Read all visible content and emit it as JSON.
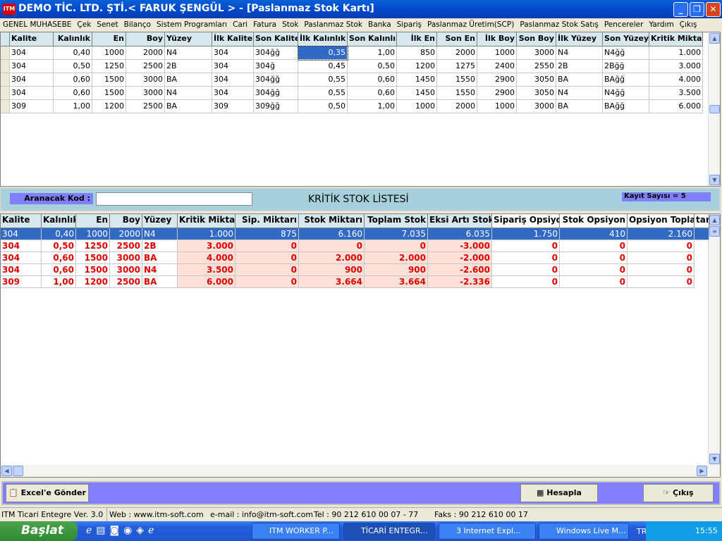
{
  "window": {
    "title": "DEMO TİC. LTD. ŞTİ.< FARUK ŞENGÜL  > - [Paslanmaz Stok Kartı]",
    "logo": "ITM",
    "minimize": "_",
    "restore": "❐",
    "close": "✕"
  },
  "menu": [
    "GENEL MUHASEBE",
    "Çek",
    "Senet",
    "Bilanço",
    "Sistem Programları",
    "Cari",
    "Fatura",
    "Stok",
    "Paslanmaz Stok",
    "Banka",
    "Sipariş",
    "Paslanmaz Üretim(SCP)",
    "Paslanmaz Stok Satış",
    "Pencereler",
    "Yardım",
    "Çıkış"
  ],
  "top_grid": {
    "columns": [
      "Kalite",
      "Kalınlık",
      "En",
      "Boy",
      "Yüzey",
      "İlk Kalite",
      "Son Kalite",
      "İlk Kalınlık",
      "Son Kalınlık",
      "İlk En",
      "Son En",
      "İlk Boy",
      "Son Boy",
      "İlk Yüzey",
      "Son Yüzey",
      "Kritik Miktar"
    ],
    "rows": [
      [
        "304",
        "0,40",
        "1000",
        "2000",
        "N4",
        "304",
        "304ğğ",
        "0,35",
        "1,00",
        "850",
        "2000",
        "1000",
        "3000",
        "N4",
        "N4ğğ",
        "1.000"
      ],
      [
        "304",
        "0,50",
        "1250",
        "2500",
        "2B",
        "304",
        "304ğ",
        "0,45",
        "0,50",
        "1200",
        "1275",
        "2400",
        "2550",
        "2B",
        "2Bğğ",
        "3.000"
      ],
      [
        "304",
        "0,60",
        "1500",
        "3000",
        "BA",
        "304",
        "304ğğ",
        "0,55",
        "0,60",
        "1450",
        "1550",
        "2900",
        "3050",
        "BA",
        "BAğğ",
        "4.000"
      ],
      [
        "304",
        "0,60",
        "1500",
        "3000",
        "N4",
        "304",
        "304ğğ",
        "0,55",
        "0,60",
        "1450",
        "1550",
        "2900",
        "3050",
        "N4",
        "N4ğğ",
        "3.500"
      ],
      [
        "309",
        "1,00",
        "1200",
        "2500",
        "BA",
        "309",
        "309ğğ",
        "0,50",
        "1,00",
        "1000",
        "2000",
        "1000",
        "3000",
        "BA",
        "BAğğ",
        "6.000"
      ]
    ]
  },
  "search": {
    "label": "Aranacak Kod :",
    "value": "",
    "title": "KRİTİK STOK LİSTESİ",
    "count": "Kayıt Sayısı = 5"
  },
  "bottom_grid": {
    "columns": [
      "Kalite",
      "Kalınlık",
      "En",
      "Boy",
      "Yüzey",
      "Kritik Miktar",
      "Sip. Miktarı",
      "Stok Miktarı",
      "Toplam Stok",
      "Eksi Artı Stok",
      "Sipariş Opsiyon",
      "Stok Opsiyon",
      "Opsiyon Toplamı",
      "tarı"
    ],
    "rows": [
      [
        "304",
        "0,40",
        "1000",
        "2000",
        "N4",
        "1.000",
        "875",
        "6.160",
        "7.035",
        "6.035",
        "1.750",
        "410",
        "2.160"
      ],
      [
        "304",
        "0,50",
        "1250",
        "2500",
        "2B",
        "3.000",
        "0",
        "0",
        "0",
        "-3.000",
        "0",
        "0",
        "0"
      ],
      [
        "304",
        "0,60",
        "1500",
        "3000",
        "BA",
        "4.000",
        "0",
        "2.000",
        "2.000",
        "-2.000",
        "0",
        "0",
        "0"
      ],
      [
        "304",
        "0,60",
        "1500",
        "3000",
        "N4",
        "3.500",
        "0",
        "900",
        "900",
        "-2.600",
        "0",
        "0",
        "0"
      ],
      [
        "309",
        "1,00",
        "1200",
        "2500",
        "BA",
        "6.000",
        "0",
        "3.664",
        "3.664",
        "-2.336",
        "0",
        "0",
        "0"
      ]
    ],
    "critical_color": "#e00000",
    "selected_color": "#316ac5"
  },
  "buttons": {
    "excel": "Excel'e Gönder",
    "hesapla": "Hesapla",
    "cikis": "Çıkış"
  },
  "status": {
    "version": "ITM Ticari Entegre Ver. 3.0",
    "web": "Web : www.itm-soft.com",
    "email": "e-mail : info@itm-soft.com",
    "tel": "Tel : 90 212 610 00 07 - 77",
    "faks": "Faks : 90 212 610 00 17"
  },
  "taskbar": {
    "start": "Başlat",
    "tasks": [
      "ITM WORKER P...",
      "TİCARİ ENTEGR...",
      "3 Internet Expl...",
      "Windows Live M..."
    ],
    "lang": "TR",
    "clock": "15:55"
  }
}
